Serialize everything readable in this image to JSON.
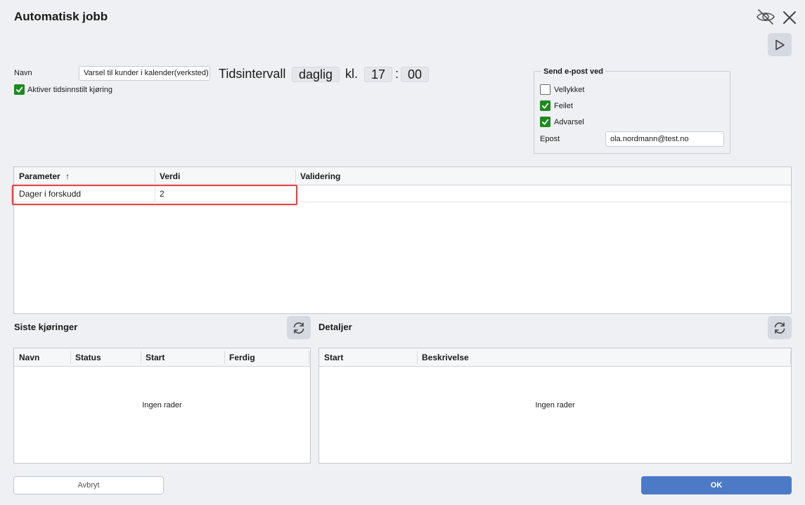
{
  "dialog": {
    "title": "Automatisk jobb"
  },
  "form": {
    "name_label": "Navn",
    "name_value": "Varsel til kunder i kalender(verksted)",
    "interval_label": "Tidsintervall",
    "interval_value": "daglig",
    "time_label": "kl.",
    "hour": "17",
    "colon": ":",
    "minute": "00",
    "activate_label": "Aktiver tidsinnstilt kjøring",
    "activate_checked": true
  },
  "email": {
    "legend": "Send e-post ved",
    "options": [
      {
        "label": "Vellykket",
        "checked": false
      },
      {
        "label": "Feilet",
        "checked": true
      },
      {
        "label": "Advarsel",
        "checked": true
      }
    ],
    "epost_label": "Epost",
    "epost_value": "ola.nordmann@test.no"
  },
  "parameters": {
    "columns": [
      "Parameter",
      "Verdi",
      "Validering"
    ],
    "sort_indicator": "↑",
    "rows": [
      {
        "parameter": "Dager i forskudd",
        "verdi": "2",
        "validering": ""
      }
    ]
  },
  "runs": {
    "title": "Siste kjøringer",
    "columns": [
      "Navn",
      "Status",
      "Start",
      "Ferdig"
    ],
    "empty": "Ingen rader"
  },
  "details": {
    "title": "Detaljer",
    "columns": [
      "Start",
      "Beskrivelse"
    ],
    "empty": "Ingen rader"
  },
  "buttons": {
    "cancel": "Avbryt",
    "ok": "OK"
  },
  "colors": {
    "accent": "#4c7ac7",
    "check": "#1f8a1f",
    "highlight": "#e0474c"
  }
}
